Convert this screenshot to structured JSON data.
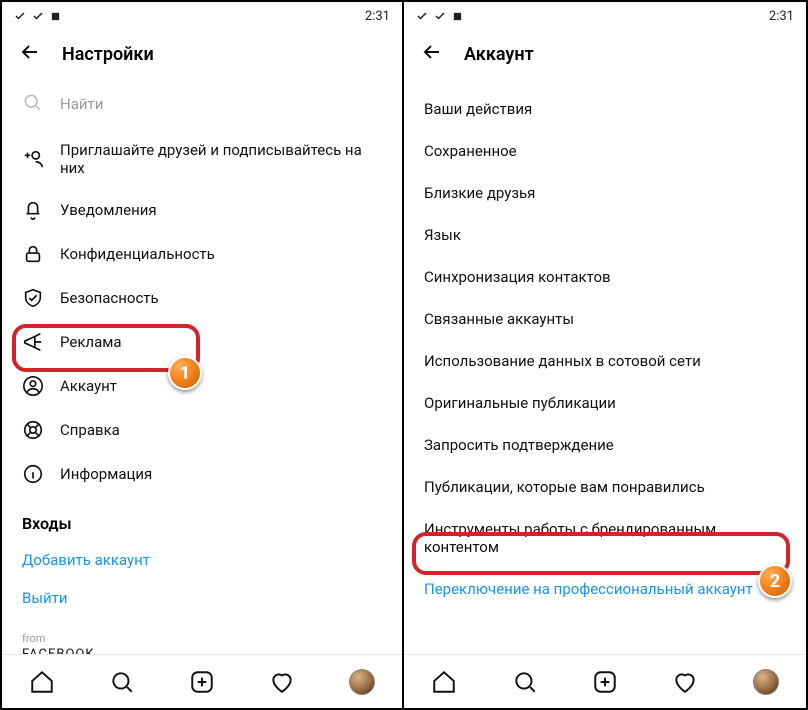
{
  "statusbar": {
    "time": "2:31"
  },
  "left": {
    "title": "Настройки",
    "search_placeholder": "Найти",
    "items": {
      "invite": "Приглашайте друзей и подписывайтесь на них",
      "notifications": "Уведомления",
      "privacy": "Конфиденциальность",
      "security": "Безопасность",
      "ads": "Реклама",
      "account": "Аккаунт",
      "help": "Справка",
      "about": "Информация"
    },
    "logins_header": "Входы",
    "add_account": "Добавить аккаунт",
    "logout": "Выйти",
    "from_label": "from",
    "facebook": "FACEBOOK"
  },
  "right": {
    "title": "Аккаунт",
    "items": {
      "activity": "Ваши действия",
      "saved": "Сохраненное",
      "close_friends": "Близкие друзья",
      "language": "Язык",
      "contacts_sync": "Синхронизация контактов",
      "linked": "Связанные аккаунты",
      "data_usage": "Использование данных в сотовой сети",
      "original_posts": "Оригинальные публикации",
      "request_verification": "Запросить подтверждение",
      "posts_liked": "Публикации, которые вам понравились",
      "branded_tools": "Инструменты работы с брендированным контентом",
      "switch_pro": "Переключение на профессиональный аккаунт"
    }
  },
  "badges": {
    "one": "1",
    "two": "2"
  }
}
